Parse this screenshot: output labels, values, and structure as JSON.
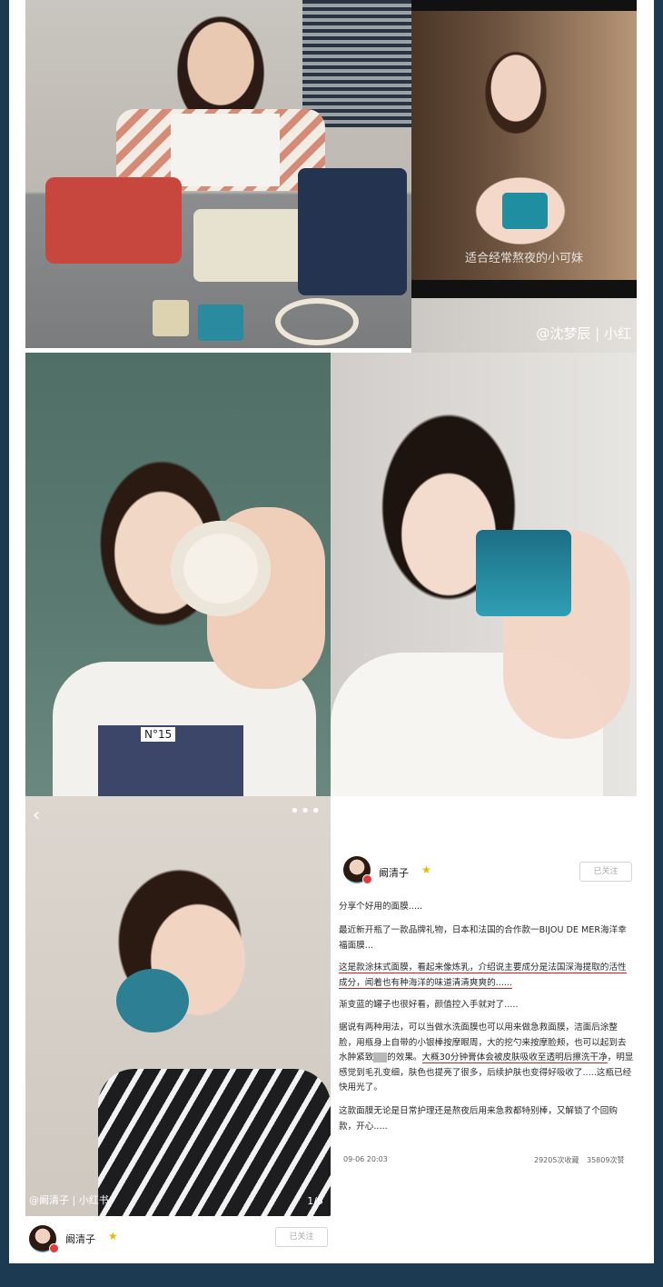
{
  "images": {
    "top_right_caption": "适合经常熬夜的小可妹",
    "tshirt_print": "N°15",
    "shen_watermark": "@沈梦辰 | 小红",
    "post_image_watermark": "@阚清子 | 小红书",
    "post_image_page": "1/5"
  },
  "post": {
    "author": "阚清子",
    "follow_label": "已关注",
    "p1": "分享个好用的面膜.....",
    "p2": "最近新开瓶了一款品牌礼物，日本和法国的合作款一BIJOU DE MER海洋幸福面膜...",
    "p3": "这是款涂抹式面膜，看起来像炼乳，介绍说主要成分是法国深海提取的活性成分，闻着也有种海洋的味道清清爽爽的......",
    "p4": "渐变蓝的罐子也很好看，颜值控入手就对了.....",
    "p5a": "据说有两种用法，可以当做水洗面膜也可以用来做急救面膜，洁面后涂整脸，用瓶身上自带的小银棒按摩眼周，大的挖勺来按摩脸颊，也可以起到去水肿紧致",
    "p5b": "的效果。",
    "p5c": "大概30分钟膏体会被皮肤吸收至透明后擦洗干净",
    "p5d": "，明显感觉到毛孔变细，肤色也提亮了很多，后续护肤也变得好吸收了.....这瓶已经快用光了。",
    "p6": "这款面膜无论是日常护理还是熬夜后用来急救都特别棒，又解锁了个回购款，开心.....",
    "date": "09-06 20:03",
    "collects": "29205次收藏",
    "likes": "35809次赞"
  },
  "bottom_profile": {
    "author": "阚清子",
    "follow_label": "已关注"
  },
  "colors": {
    "page_background": "#1d3a53",
    "underline": "#d11e1e",
    "verified_star": "#e9b800"
  }
}
